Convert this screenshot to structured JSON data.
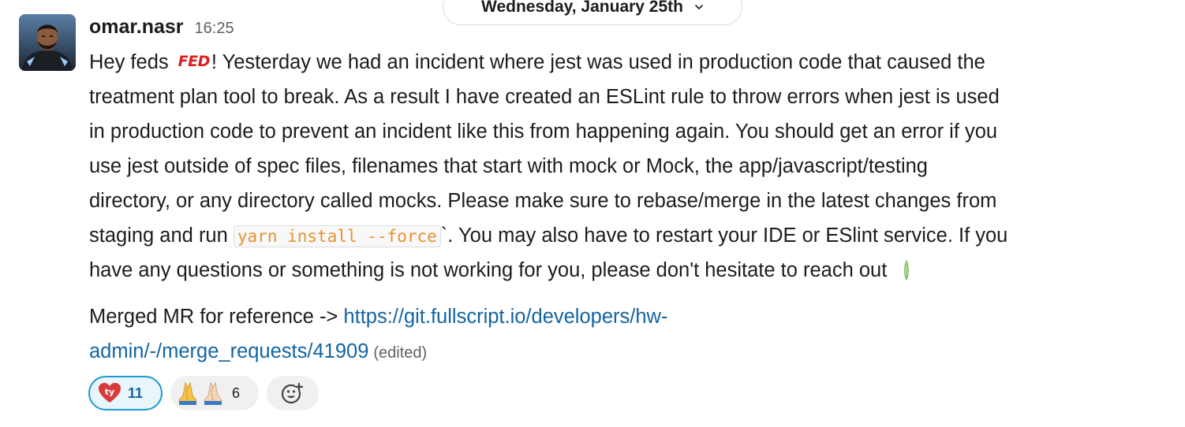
{
  "date_divider": {
    "label": "Wednesday, January 25th"
  },
  "message": {
    "author": "omar.nasr",
    "time": "16:25",
    "lines": [
      {
        "before": "Hey feds",
        "emoji_text": "FED",
        "after": "! Yesterday we had an incident where jest was used in production code that caused the"
      },
      {
        "text": "treatment plan tool to break. As a result I have created an ESLint rule to throw errors when jest is used"
      },
      {
        "text": "in production code to prevent an incident like this from happening again. You should get an error if you"
      },
      {
        "text": "use jest outside of spec files, filenames that start with mock or Mock, the app/javascript/testing"
      },
      {
        "text": "directory, or any directory called mocks.  Please make sure to rebase/merge in the latest changes from"
      },
      {
        "before": "staging and run",
        "code": "yarn install --force",
        "after": "`.  You may also have to restart your IDE or ESlint service.  If you"
      },
      {
        "text": "have any questions or something is not working for you, please don't hesitate to reach out"
      }
    ],
    "ref_label": "Merged MR for reference ->",
    "link_line1": "https://git.fullscript.io/developers/hw-",
    "link_line2": "admin/-/merge_requests/41909",
    "edited": "(edited)"
  },
  "reactions": [
    {
      "icon": "heart-ty-icon",
      "count": "11",
      "mine": true
    },
    {
      "icon": "praying-hands-icon",
      "count": "6",
      "mine": false
    }
  ],
  "add_reaction": {
    "icon": "add-reaction-icon"
  },
  "colors": {
    "link": "#1264a3",
    "code": "#e8912d",
    "fed_red": "#e01e1e",
    "reaction_border": "#1d9bd1"
  }
}
